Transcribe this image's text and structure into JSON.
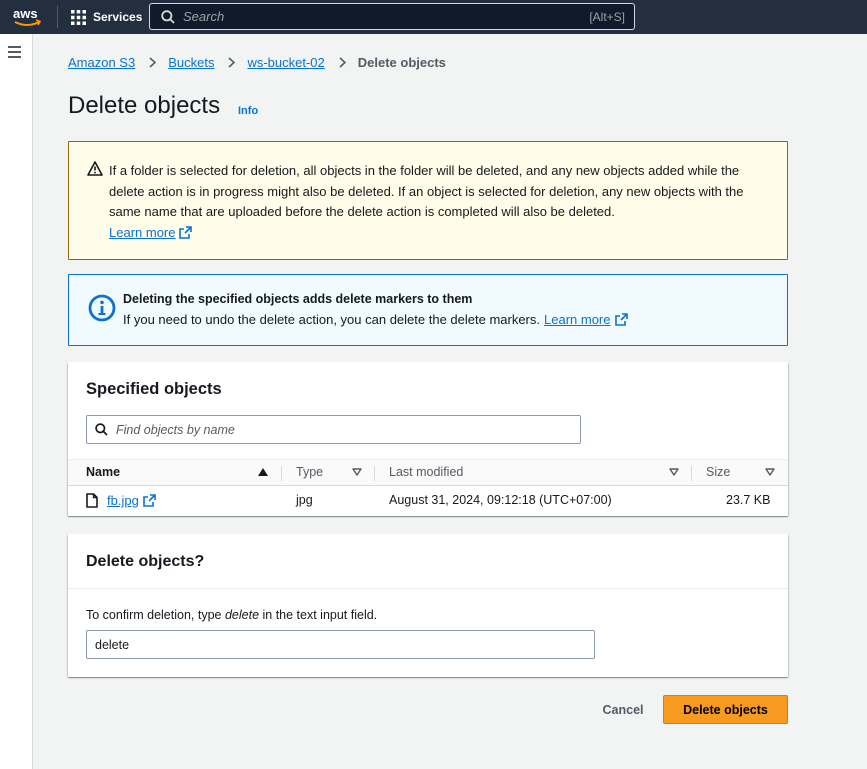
{
  "nav": {
    "logo_text": "aws",
    "services_label": "Services",
    "search_placeholder": "Search",
    "search_shortcut": "[Alt+S]"
  },
  "breadcrumb": {
    "items": [
      "Amazon S3",
      "Buckets",
      "ws-bucket-02"
    ],
    "current": "Delete objects"
  },
  "page": {
    "title": "Delete objects",
    "info_label": "Info"
  },
  "warning_alert": {
    "text": "If a folder is selected for deletion, all objects in the folder will be deleted, and any new objects added while the delete action is in progress might also be deleted. If an object is selected for deletion, any new objects with the same name that are uploaded before the delete action is completed will also be deleted.",
    "learn_more": "Learn more"
  },
  "info_alert": {
    "heading": "Deleting the specified objects adds delete markers to them",
    "body": "If you need to undo the delete action, you can delete the delete markers.",
    "learn_more": "Learn more"
  },
  "objects_panel": {
    "title": "Specified objects",
    "filter_placeholder": "Find objects by name",
    "columns": {
      "name": "Name",
      "type": "Type",
      "last_modified": "Last modified",
      "size": "Size"
    },
    "rows": [
      {
        "name": "fb.jpg",
        "type": "jpg",
        "last_modified": "August 31, 2024, 09:12:18 (UTC+07:00)",
        "size": "23.7 KB"
      }
    ]
  },
  "delete_panel": {
    "title": "Delete objects?",
    "confirm_prefix": "To confirm deletion, type ",
    "confirm_keyword": "delete",
    "confirm_suffix": " in the text input field.",
    "input_value": "delete"
  },
  "actions": {
    "cancel": "Cancel",
    "delete": "Delete objects"
  },
  "colors": {
    "nav_bg": "#232f3e",
    "link": "#0972d3",
    "warning_bg": "#fffce9",
    "warning_border": "#8d6605",
    "info_bg": "#f1faff",
    "info_border": "#0972d3",
    "primary_button": "#f79a1f"
  },
  "icons": [
    "aws-logo",
    "services-grid-icon",
    "search-icon",
    "menu-icon",
    "chevron-right-icon",
    "warning-icon",
    "external-link-icon",
    "info-icon",
    "sort-ascending-icon",
    "sort-descending-icon",
    "file-icon"
  ]
}
